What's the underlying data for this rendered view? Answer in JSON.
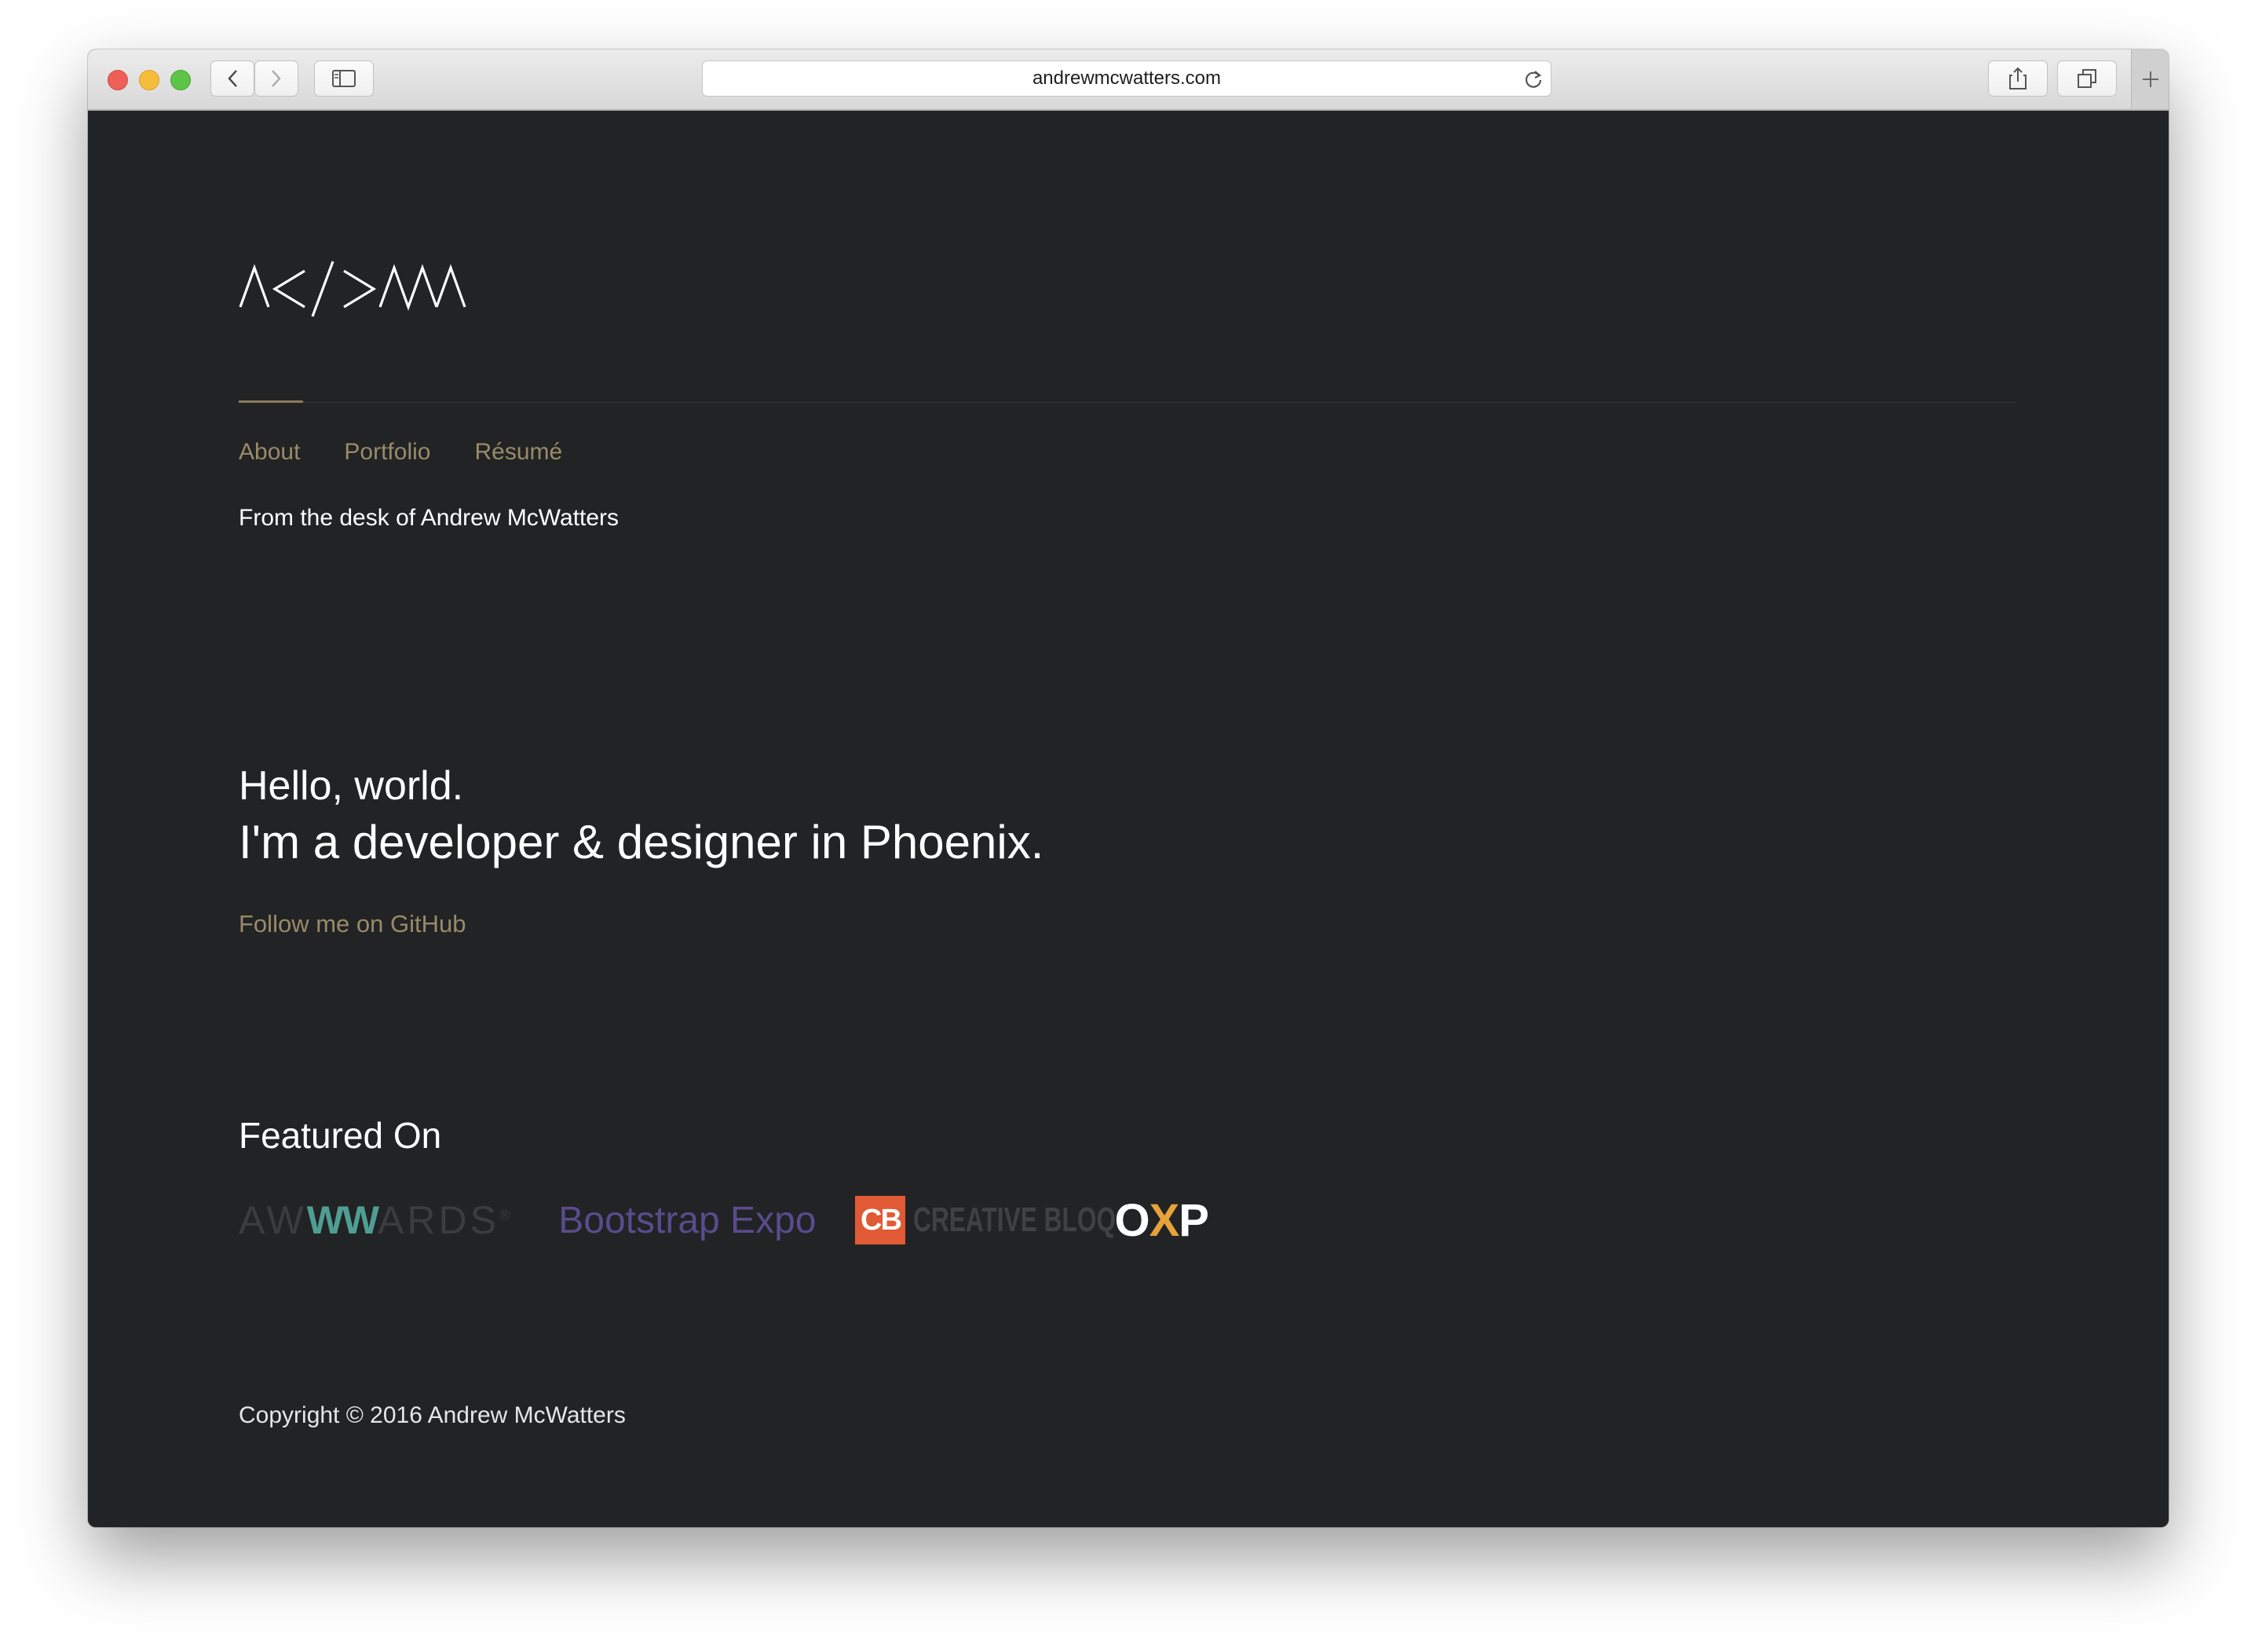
{
  "browser": {
    "url": "andrewmcwatters.com"
  },
  "nav": {
    "items": [
      {
        "label": "About"
      },
      {
        "label": "Portfolio"
      },
      {
        "label": "Résumé"
      }
    ]
  },
  "header": {
    "tagline": "From the desk of Andrew McWatters"
  },
  "hero": {
    "line1": "Hello, world.",
    "line2": "I'm a developer & designer in Phoenix.",
    "link": "Follow me on GitHub"
  },
  "featured": {
    "title": "Featured On",
    "logos": {
      "awwwards_pre": "AW",
      "awwwards_mid": "WW",
      "awwwards_post": "ARDS",
      "awwwards_mark": "®",
      "bootstrap": "Bootstrap Expo",
      "cb_badge": "CB",
      "cb_text": "CREATIVE BLOQ",
      "oxp_o": "O",
      "oxp_x": "X",
      "oxp_p": "P"
    }
  },
  "footer": {
    "copyright": "Copyright © 2016 Andrew McWatters"
  },
  "colors": {
    "page_bg": "#212325",
    "accent": "#9a8a68",
    "awwwards_accent": "#4f9e93",
    "bootstrap": "#5a4b8c",
    "creative_bloq": "#e05a35"
  }
}
